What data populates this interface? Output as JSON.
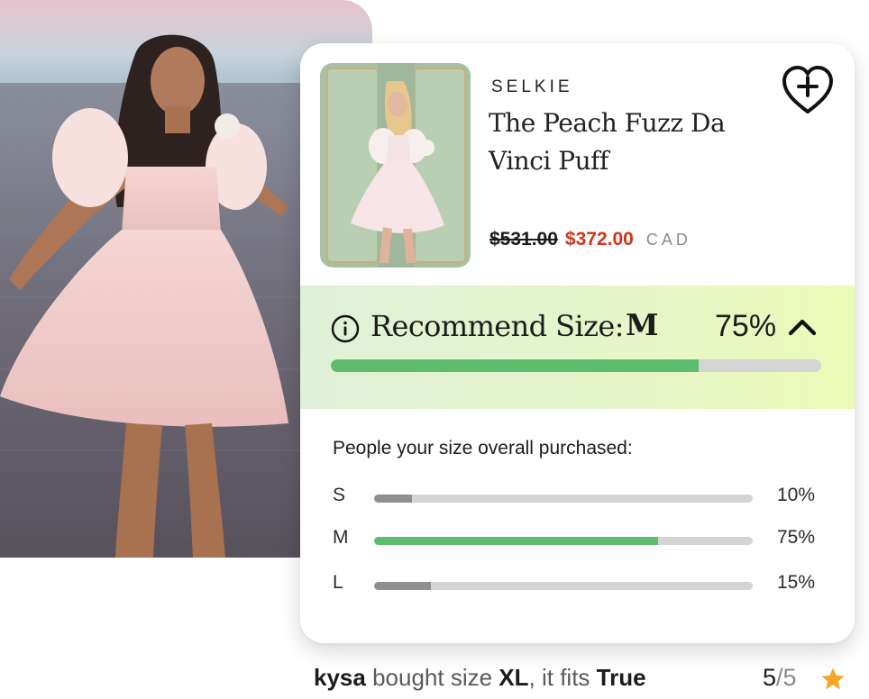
{
  "product": {
    "brand": "SELKIE",
    "title": "The Peach Fuzz Da Vinci Puff",
    "price_original": "$531.00",
    "price_sale": "$372.00",
    "currency": "CAD"
  },
  "icons": {
    "wishlist": "heart-plus-icon",
    "info": "info-icon",
    "collapse": "chevron-up-icon",
    "rating": "star-icon"
  },
  "recommendation": {
    "label": "Recommend Size:",
    "size": "M",
    "percent_text": "75%",
    "percent_value": 75
  },
  "distribution": {
    "title": "People your size overall purchased:",
    "rows": [
      {
        "size": "S",
        "percent_text": "10%",
        "value": 10,
        "color": "#8f8f8f"
      },
      {
        "size": "M",
        "percent_text": "75%",
        "value": 75,
        "color": "#5ebd6d"
      },
      {
        "size": "L",
        "percent_text": "15%",
        "value": 15,
        "color": "#8f8f8f"
      }
    ]
  },
  "review": {
    "username": "kysa",
    "text_bought": "bought size",
    "size": "XL",
    "text_fits": ", it fits",
    "fit": "True",
    "score": "5",
    "slash": "/",
    "max": "5"
  },
  "colors": {
    "sale_red": "#d0361a",
    "bar_green": "#5ebd6d",
    "bar_track": "#d4d4d4",
    "band_start": "#dff0d8",
    "band_end": "#ecfab7",
    "star": "#f5a623"
  }
}
